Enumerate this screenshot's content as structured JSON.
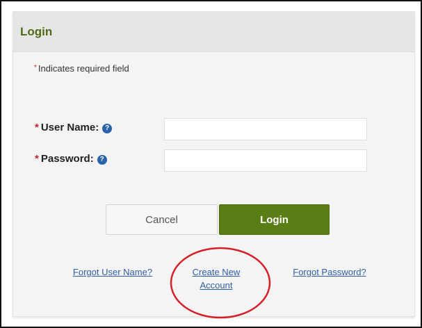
{
  "panel": {
    "title": "Login",
    "required_note": "Indicates required field",
    "required_marker": "*"
  },
  "form": {
    "username": {
      "label": "User Name:",
      "value": "",
      "help_icon": "question-circle-icon"
    },
    "password": {
      "label": "Password:",
      "value": "",
      "help_icon": "question-circle-icon"
    }
  },
  "buttons": {
    "cancel_label": "Cancel",
    "login_label": "Login"
  },
  "links": {
    "forgot_username": "Forgot User Name?",
    "create_account_line1": "Create New",
    "create_account_line2": "Account",
    "forgot_password": "Forgot Password?"
  },
  "annotation": {
    "shape": "ellipse",
    "color": "#d4202a",
    "target": "create-account-link"
  },
  "colors": {
    "brand_green": "#5a7d15",
    "title_green": "#4e6a17",
    "link_blue": "#2f5fa0",
    "required_red": "#c0262c",
    "help_icon_blue": "#2a63a8"
  }
}
